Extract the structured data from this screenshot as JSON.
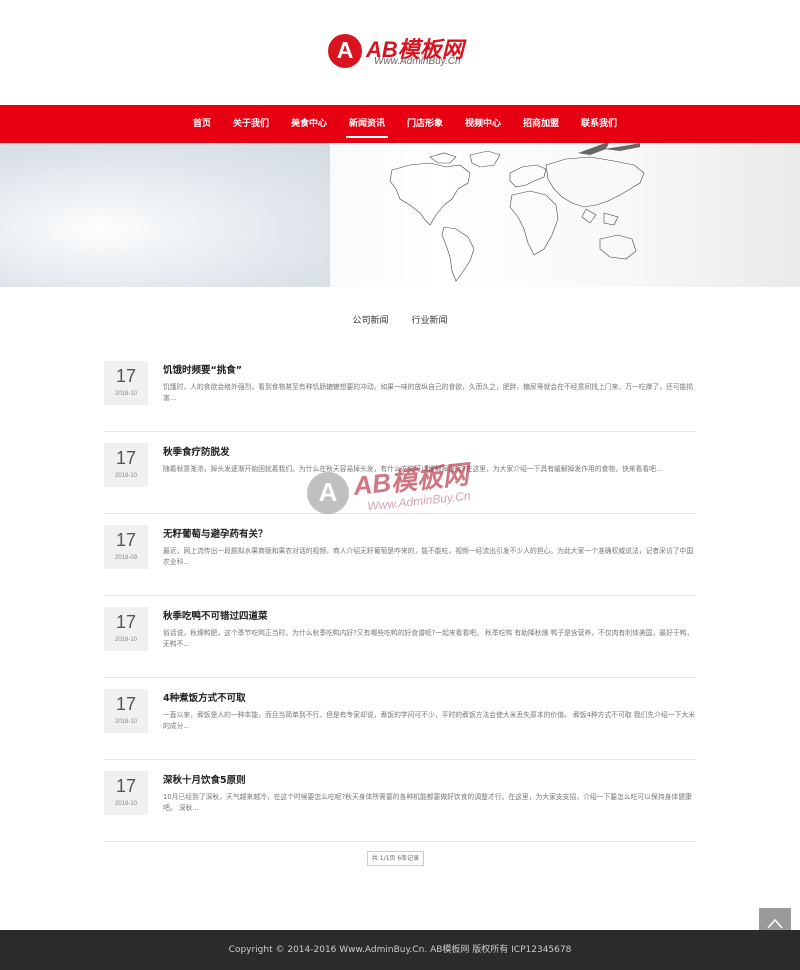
{
  "brand": {
    "logo_letter": "A",
    "logo_text": "AB模板网",
    "logo_sub": "Www.AdminBuy.Cn",
    "accent": "#e60012"
  },
  "nav": {
    "items": [
      {
        "label": "首页"
      },
      {
        "label": "关于我们"
      },
      {
        "label": "美食中心"
      },
      {
        "label": "新闻资讯",
        "active": true
      },
      {
        "label": "门店形象"
      },
      {
        "label": "视频中心"
      },
      {
        "label": "招商加盟"
      },
      {
        "label": "联系我们"
      }
    ]
  },
  "tabs": [
    {
      "label": "公司新闻"
    },
    {
      "label": "行业新闻"
    }
  ],
  "news": [
    {
      "day": "17",
      "ym": "2018-10",
      "title": "饥饿时频要“挑食”",
      "desc": "饥饿时，人的食欲会格外强烈，看到食物甚至有种饥肠辘辘想要的冲动。如果一味的放纵自己的食欲，久而久之，肥胖、糖尿等就会在不经意间找上门来。万一吃撑了，还可能损害..."
    },
    {
      "day": "17",
      "ym": "2018-10",
      "title": "秋季食疗防脱发",
      "desc": "随着秋意渐浓，掉头发逐渐开始困扰着我们。为什么在秋天容易掉头发，有什么方法可以缓解掉发呢?在这里，为大家介绍一下具有缓解掉发作用的食物，快来看看吧..."
    },
    {
      "day": "17",
      "ym": "2018-09",
      "title": "无籽葡萄与避孕药有关？",
      "desc": "最近，网上流传出一段题拟水果商贩和果农对话的视频，商人介绍无籽葡萄是咋来的，能不能吃，视频一经流出引发不少人的担心。为此大家一个准确权威说法，记者采访了中国农业科..."
    },
    {
      "day": "17",
      "ym": "2018-10",
      "title": "秋季吃鸭不可错过四道菜",
      "desc": "俗话说，秋燥鸭肥，这个季节吃鸭正当时。为什么秋季吃鸭内好?又有哪些吃鸭的好食谱呢?一起来看看吧。 秋季吃鸭 有助降秋燥 鸭子是含营养，不仅肉有利体美国，最好于鸭，无鸭不..."
    },
    {
      "day": "17",
      "ym": "2018-10",
      "title": "4种煮饭方式不可取",
      "desc": "一直以来，煮饭是人的一种本能，而且当简单到不行。但是有专家却说，煮饭的学问可不少，平时的煮饭方法会使大米丢失原本的价值。 煮饭4种方式不可取 我们先介绍一下大米的成分..."
    },
    {
      "day": "17",
      "ym": "2018-10",
      "title": "深秋十月饮食5原则",
      "desc": "10月已经到了深秋，天气越来越冷，在这个时候要怎么吃呢?秋天身体所需要的各种机能都要做好饮食的调整才行。在这里，为大家支支招，介绍一下要怎么吃可以保持身体健康吧。 深秋..."
    }
  ],
  "pager": {
    "label": "共 1/1页 6条记录"
  },
  "watermark": {
    "letter": "A",
    "text": "AB模板网",
    "sub": "Www.AdminBuy.Cn"
  },
  "footer": {
    "text": "Copyright © 2014-2016 Www.AdminBuy.Cn. AB模板网 版权所有   ICP12345678"
  }
}
